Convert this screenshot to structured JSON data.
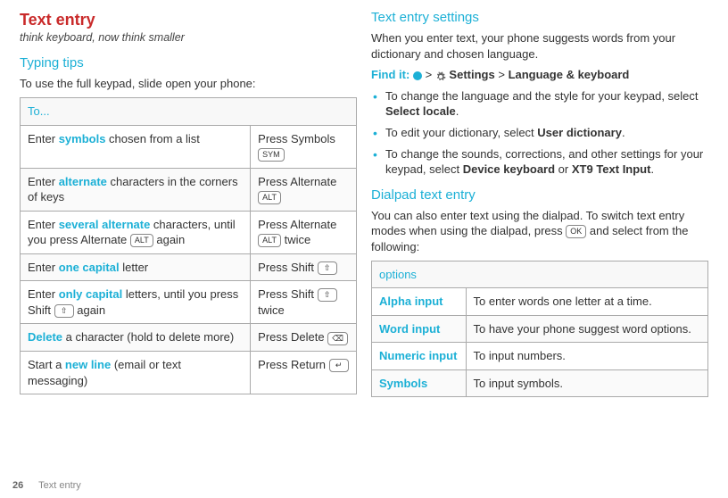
{
  "left": {
    "title": "Text entry",
    "subtitle": "think keyboard, now think smaller",
    "section": "Typing tips",
    "intro": "To use the full keypad, slide open your phone:",
    "table_header": "To...",
    "rows": [
      {
        "a1": "Enter ",
        "kw": "symbols",
        "a2": " chosen from a list",
        "b1": "Press Symbols ",
        "key": "SYM"
      },
      {
        "a1": "Enter ",
        "kw": "alternate",
        "a2": " characters in the corners of keys",
        "b1": "Press Alternate ",
        "key": "ALT"
      },
      {
        "a1": "Enter ",
        "kw": "several alternate",
        "a2": " characters, until you press Alternate ",
        "key_inline": "ALT",
        "a3": " again",
        "b1": "Press Alternate ",
        "key": "ALT",
        "b2": " twice"
      },
      {
        "a1": "Enter ",
        "kw": "one capital",
        "a2": " letter",
        "b1": "Press Shift ",
        "key": "⇧"
      },
      {
        "a1": "Enter ",
        "kw": "only capital",
        "a2": " letters, until you press Shift ",
        "key_inline": "⇧",
        "a3": " again",
        "b1": "Press Shift ",
        "key": "⇧",
        "b2": " twice"
      },
      {
        "a0": "",
        "kw": "Delete",
        "a2": " a character (hold to delete more)",
        "b1": "Press Delete ",
        "key": "⌫"
      },
      {
        "a1": "Start a ",
        "kw": "new line",
        "a2": " (email or text messaging)",
        "b1": "Press Return ",
        "key": "↵"
      }
    ]
  },
  "right": {
    "section1": "Text entry settings",
    "intro1": "When you enter text, your phone suggests words from your dictionary and chosen language.",
    "findit_label": "Find it:",
    "gt": ">",
    "settings": "Settings",
    "langkb": "Language & keyboard",
    "bul1a": "To change the language and the style for your keypad, select ",
    "bul1b": "Select locale",
    "bul2a": "To edit your dictionary, select ",
    "bul2b": "User dictionary",
    "bul3a": "To change the sounds, corrections, and other settings for your keypad, select ",
    "bul3b": "Device keyboard",
    "bul3c": " or ",
    "bul3d": "XT9 Text Input",
    "section2": "Dialpad text entry",
    "intro2a": "You can also enter text using the dialpad. To switch text entry modes when using the dialpad, press ",
    "okkey": "OK",
    "intro2b": " and select from the following:",
    "opt_header": "options",
    "opts": [
      {
        "name": "Alpha input",
        "desc": "To enter words one letter at a time."
      },
      {
        "name": "Word input",
        "desc": "To have your phone suggest word options."
      },
      {
        "name": "Numeric input",
        "desc": "To input numbers."
      },
      {
        "name": "Symbols",
        "desc": "To input symbols."
      }
    ]
  },
  "footer": {
    "page": "26",
    "section": "Text entry"
  }
}
